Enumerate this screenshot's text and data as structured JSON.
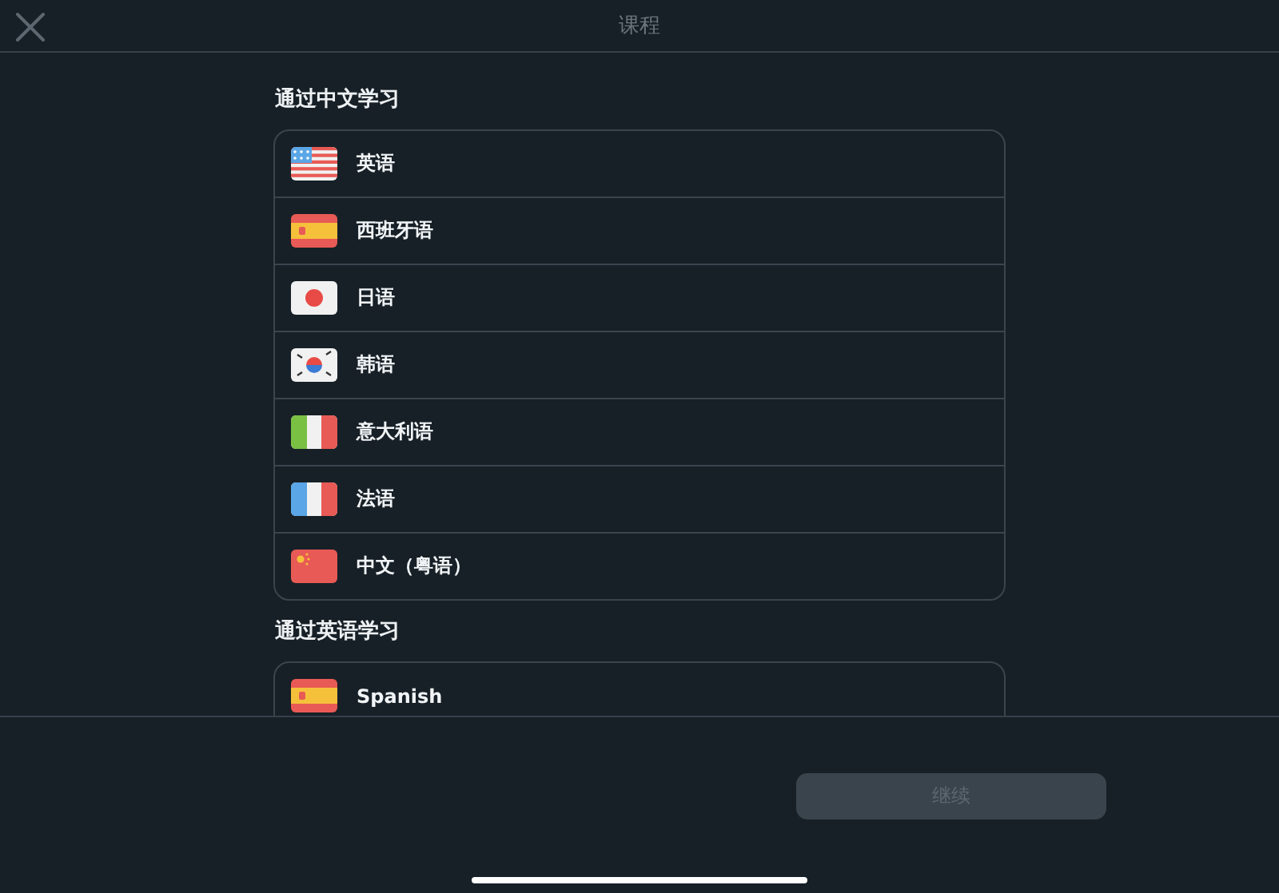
{
  "header": {
    "title": "课程"
  },
  "sections": [
    {
      "title": "通过中文学习",
      "courses": [
        {
          "kind": "us",
          "name": "英语"
        },
        {
          "kind": "es",
          "name": "西班牙语"
        },
        {
          "kind": "jp",
          "name": "日语"
        },
        {
          "kind": "kr",
          "name": "韩语"
        },
        {
          "kind": "it",
          "name": "意大利语"
        },
        {
          "kind": "fr",
          "name": "法语"
        },
        {
          "kind": "cn",
          "name": "中文（粤语）"
        }
      ]
    },
    {
      "title": "通过英语学习",
      "courses": [
        {
          "kind": "es",
          "name": "Spanish"
        }
      ]
    }
  ],
  "continue_button": {
    "label": "继续",
    "disabled": true
  }
}
